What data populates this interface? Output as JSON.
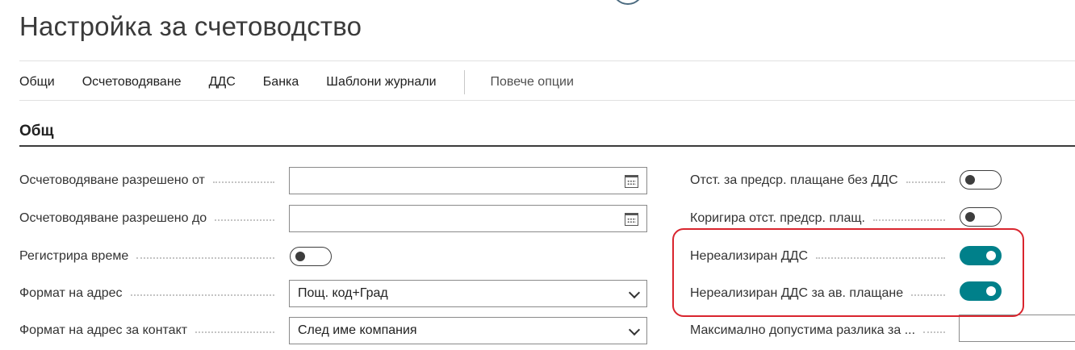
{
  "page": {
    "title": "Настройка за счетоводство"
  },
  "actionbar": {
    "items": [
      "Общи",
      "Осчетоводяване",
      "ДДС",
      "Банка",
      "Шаблони журнали"
    ],
    "more": "Повече опции"
  },
  "section": {
    "title": "Общ"
  },
  "left_fields": [
    {
      "label": "Осчетоводяване разрешено от",
      "value": "",
      "control": "date"
    },
    {
      "label": "Осчетоводяване разрешено до",
      "value": "",
      "control": "date"
    },
    {
      "label": "Регистрира време",
      "control": "toggle",
      "on": false
    },
    {
      "label": "Формат на адрес",
      "value": "Пощ. код+Град",
      "control": "select"
    },
    {
      "label": "Формат на адрес за контакт",
      "value": "След име компания",
      "control": "select"
    }
  ],
  "right_fields": [
    {
      "label": "Отст. за предср. плащане без ДДС",
      "control": "toggle",
      "on": false
    },
    {
      "label": "Коригира отст. предср. плащ.",
      "control": "toggle",
      "on": false
    },
    {
      "label": "Нереализиран ДДС",
      "control": "toggle",
      "on": true
    },
    {
      "label": "Нереализиран ДДС за ав. плащане",
      "control": "toggle",
      "on": true
    },
    {
      "label": "Максимално допустима разлика за ...",
      "value": "",
      "control": "text"
    }
  ],
  "colors": {
    "toggle_on": "#00808a",
    "highlight": "#d9252e"
  }
}
